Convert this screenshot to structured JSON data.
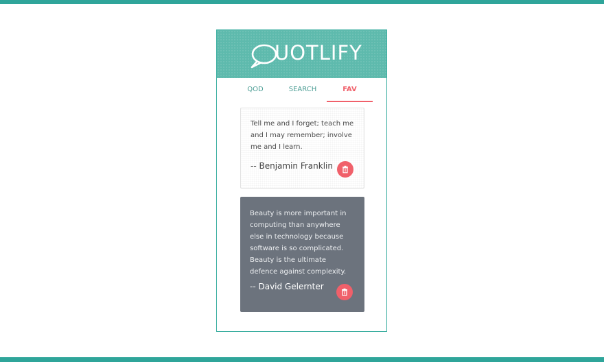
{
  "app": {
    "logo_text": "UOTLIFY",
    "logo_icon": "speech-bubble-q-icon"
  },
  "tabs": [
    {
      "label": "QOD",
      "active": false
    },
    {
      "label": "SEARCH",
      "active": false
    },
    {
      "label": "FAV",
      "active": true
    }
  ],
  "favorites": [
    {
      "text": "Tell me and I forget; teach me and I may remember; involve me and I learn.",
      "author": "-- Benjamin Franklin",
      "delete_icon": "trash-icon"
    },
    {
      "text": "Beauty is more important in computing than anywhere else in technology because software is so complicated. Beauty is the ultimate defence against complexity.",
      "author": "-- David Gelernter",
      "delete_icon": "trash-icon"
    }
  ],
  "colors": {
    "accent": "#2fa59a",
    "header": "#5ebaad",
    "active_tab": "#f0606a",
    "dark_card": "#6c737d",
    "delete_button": "#f0606a"
  }
}
